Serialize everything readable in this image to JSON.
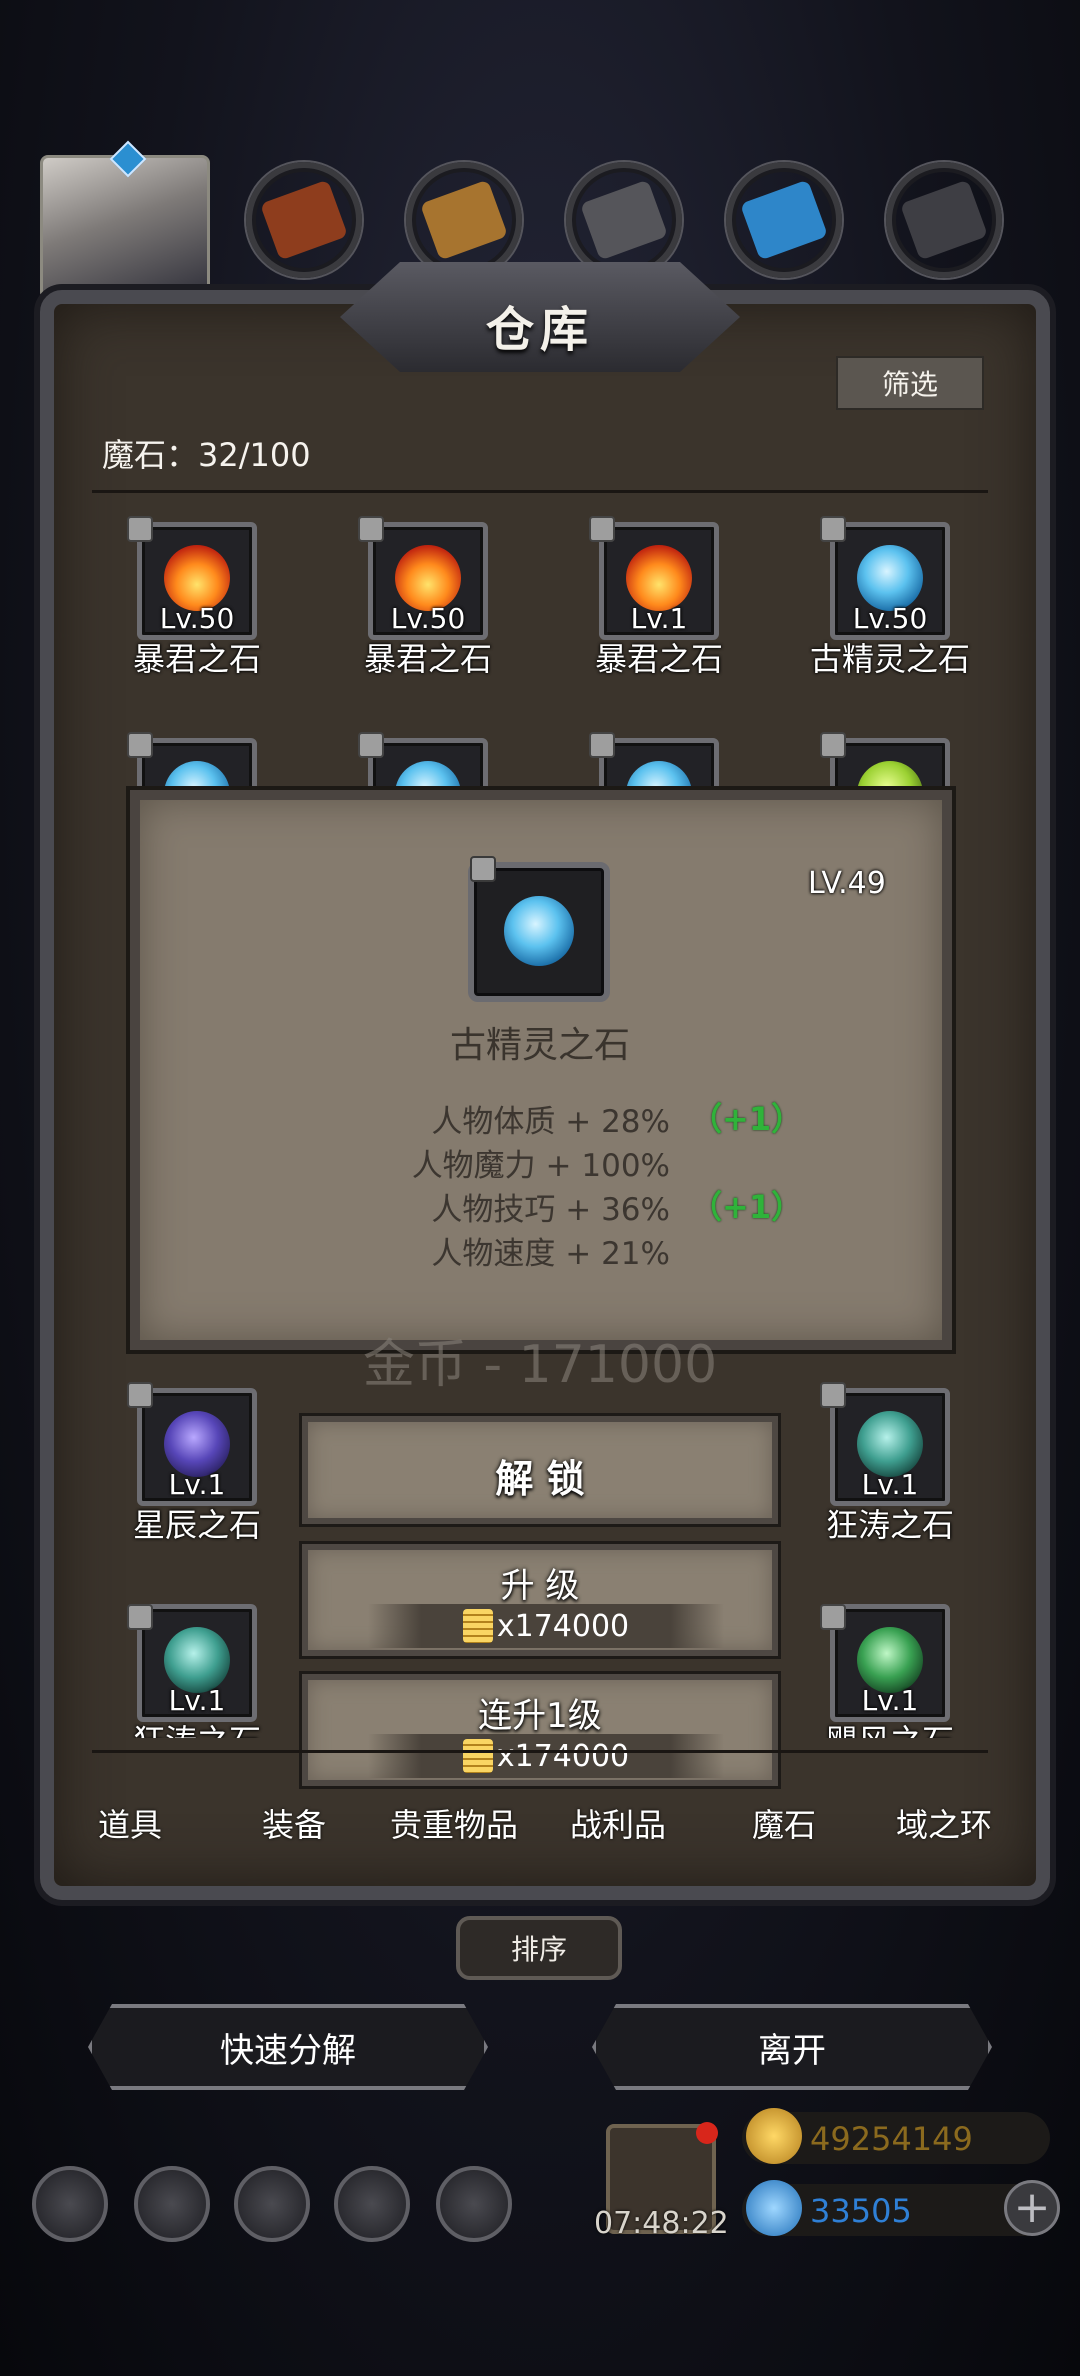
{
  "panel": {
    "title": "仓库",
    "filter_label": "筛选",
    "stone_count": "魔石：32/100"
  },
  "grid": {
    "row1": [
      {
        "level": "Lv.50",
        "name": "暴君之石",
        "type": "fire"
      },
      {
        "level": "Lv.50",
        "name": "暴君之石",
        "type": "fire"
      },
      {
        "level": "Lv.1",
        "name": "暴君之石",
        "type": "fire"
      },
      {
        "level": "Lv.50",
        "name": "古精灵之石",
        "type": "ice"
      }
    ],
    "row_bottom1": [
      {
        "level": "Lv.1",
        "name": "星辰之石",
        "type": "star"
      },
      {
        "level": "Lv.1",
        "name": "狂涛之石",
        "type": "storm"
      }
    ],
    "row_bottom2": [
      {
        "level": "Lv.1",
        "name": "狂涛之石",
        "type": "storm"
      },
      {
        "level": "Lv.1",
        "name": "飓风之石",
        "type": "gale"
      }
    ]
  },
  "detail": {
    "level": "LV.49",
    "name": "古精灵之石",
    "stats": [
      {
        "text": "人物体质 + 28%",
        "bonus": "（+1）"
      },
      {
        "text": "人物魔力 + 100%",
        "bonus": ""
      },
      {
        "text": "人物技巧 + 36%",
        "bonus": "（+1）"
      },
      {
        "text": "人物速度 + 21%",
        "bonus": ""
      }
    ],
    "gold_ghost": "金币 - 171000"
  },
  "actions": {
    "unlock": "解 锁",
    "upgrade": "升 级",
    "upgrade_cost": "x174000",
    "upgrade1": "连升1级",
    "upgrade1_cost": "x174000"
  },
  "tabs": [
    "道具",
    "装备",
    "贵重物品",
    "战利品",
    "魔石",
    "域之环"
  ],
  "sort_label": "排序",
  "buttons": {
    "quick_decompose": "快速分解",
    "leave": "离开"
  },
  "hud": {
    "timer": "07:48:22",
    "gold": "49254149",
    "gems": "33505",
    "plus": "+"
  },
  "colors": {
    "panel_bg": "#3b342c",
    "popup_bg": "#857b6e",
    "bonus_green": "#2fb33a",
    "gold_text": "#8b6a1e",
    "gem_text": "#2f80d6"
  }
}
